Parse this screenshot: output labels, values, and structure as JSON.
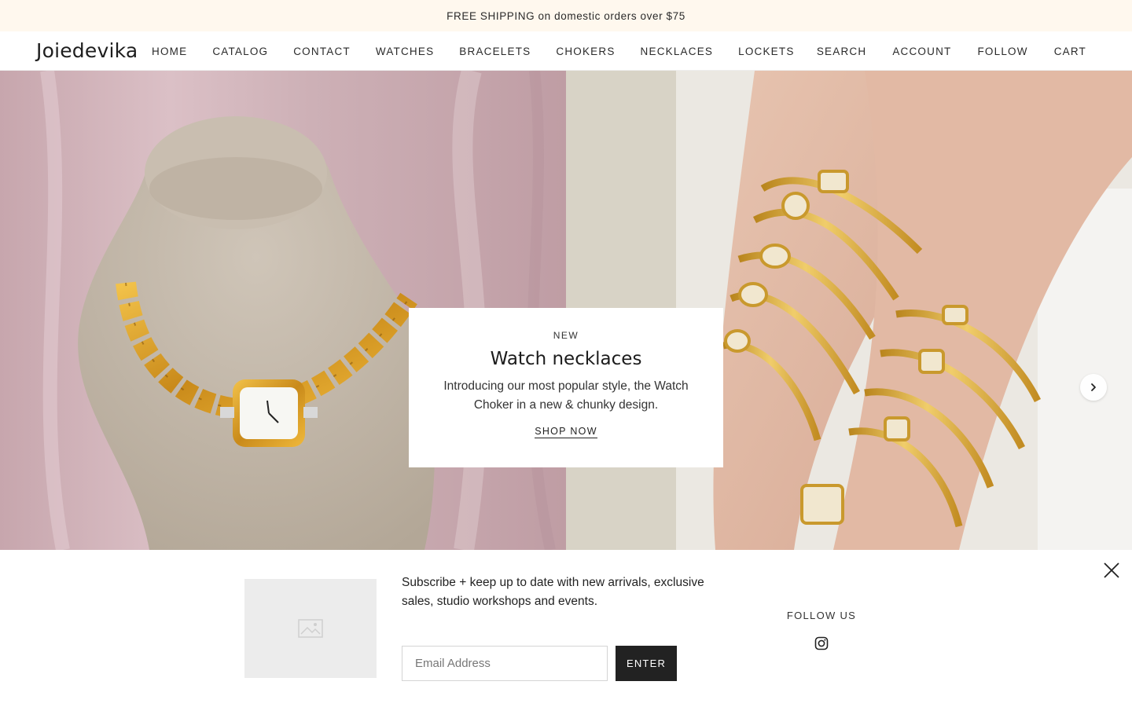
{
  "announcement": "FREE SHIPPING on domestic orders over $75",
  "header": {
    "logo": "Joiedevika",
    "nav_left": [
      "HOME",
      "CATALOG",
      "CONTACT",
      "WATCHES",
      "BRACELETS",
      "CHOKERS",
      "NECKLACES",
      "LOCKETS"
    ],
    "nav_right": [
      "SEARCH",
      "ACCOUNT",
      "FOLLOW",
      "CART"
    ]
  },
  "hero": {
    "eyebrow": "NEW",
    "title": "Watch necklaces",
    "description": "Introducing our most popular style, the Watch Choker in a new & chunky design.",
    "cta": "SHOP NOW",
    "next_icon": "chevron-right-icon"
  },
  "popup": {
    "image_icon": "image-placeholder-icon",
    "text": "Subscribe + keep up to date with new arrivals, exclusive sales, studio workshops and events.",
    "email_placeholder": "Email Address",
    "submit_label": "ENTER",
    "follow_heading": "FOLLOW US",
    "social_icon": "instagram-icon",
    "close_icon": "close-icon"
  },
  "colors": {
    "announcement_bg": "#fff8ee",
    "button_bg": "#222222",
    "placeholder_bg": "#ececec"
  }
}
